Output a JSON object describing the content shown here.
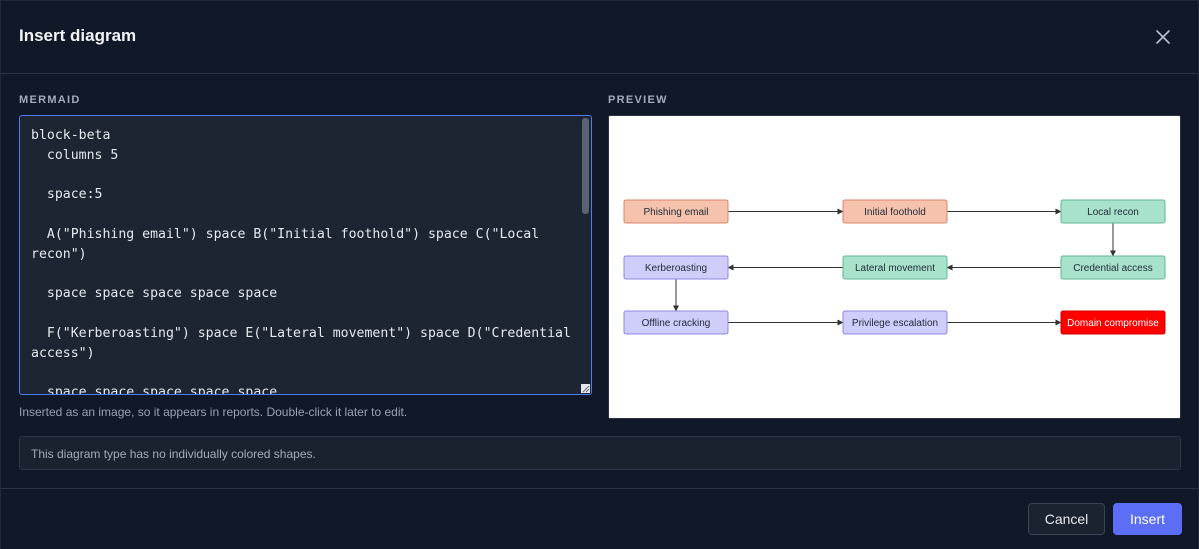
{
  "dialog": {
    "title": "Insert diagram",
    "close_icon": "close-icon"
  },
  "mermaid": {
    "label": "MERMAID",
    "code": "block-beta\n  columns 5\n\n  space:5\n\n  A(\"Phishing email\") space B(\"Initial foothold\") space C(\"Local recon\")\n\n  space space space space space\n\n  F(\"Kerberoasting\") space E(\"Lateral movement\") space D(\"Credential access\")\n\n  space space space space space"
  },
  "hint": "Inserted as an image, so it appears in reports. Double-click it later to edit.",
  "preview": {
    "label": "PREVIEW",
    "nodes": [
      {
        "id": "A",
        "label": "Phishing email",
        "fill": "#f4c2ad",
        "stroke": "#d9866b",
        "text_color": "#1f2937",
        "row": 0,
        "col": 0
      },
      {
        "id": "B",
        "label": "Initial foothold",
        "fill": "#f4c2ad",
        "stroke": "#d9866b",
        "text_color": "#1f2937",
        "row": 0,
        "col": 1
      },
      {
        "id": "C",
        "label": "Local recon",
        "fill": "#a8e2cb",
        "stroke": "#5fb895",
        "text_color": "#1f2937",
        "row": 0,
        "col": 2
      },
      {
        "id": "F",
        "label": "Kerberoasting",
        "fill": "#cfcdfa",
        "stroke": "#8c88e0",
        "text_color": "#1f2937",
        "row": 1,
        "col": 0
      },
      {
        "id": "E",
        "label": "Lateral movement",
        "fill": "#a8e2cb",
        "stroke": "#5fb895",
        "text_color": "#1f2937",
        "row": 1,
        "col": 1
      },
      {
        "id": "D",
        "label": "Credential access",
        "fill": "#a8e2cb",
        "stroke": "#5fb895",
        "text_color": "#1f2937",
        "row": 1,
        "col": 2
      },
      {
        "id": "G",
        "label": "Offline cracking",
        "fill": "#cfcdfa",
        "stroke": "#8c88e0",
        "text_color": "#1f2937",
        "row": 2,
        "col": 0
      },
      {
        "id": "H",
        "label": "Privilege escalation",
        "fill": "#cfcdfa",
        "stroke": "#8c88e0",
        "text_color": "#1f2937",
        "row": 2,
        "col": 1
      },
      {
        "id": "I",
        "label": "Domain compromise",
        "fill": "#ff0000",
        "stroke": "#cc0000",
        "text_color": "#ffffff",
        "row": 2,
        "col": 2
      }
    ],
    "edges": [
      {
        "from": "A",
        "to": "B"
      },
      {
        "from": "B",
        "to": "C"
      },
      {
        "from": "C",
        "to": "D"
      },
      {
        "from": "D",
        "to": "E"
      },
      {
        "from": "E",
        "to": "F"
      },
      {
        "from": "F",
        "to": "G"
      },
      {
        "from": "G",
        "to": "H"
      },
      {
        "from": "H",
        "to": "I"
      }
    ]
  },
  "notice": "This diagram type has no individually colored shapes.",
  "footer": {
    "cancel_label": "Cancel",
    "insert_label": "Insert"
  },
  "colors": {
    "accent": "#5b6ef5",
    "focus_border": "#4f7bf0",
    "background": "#111827"
  }
}
